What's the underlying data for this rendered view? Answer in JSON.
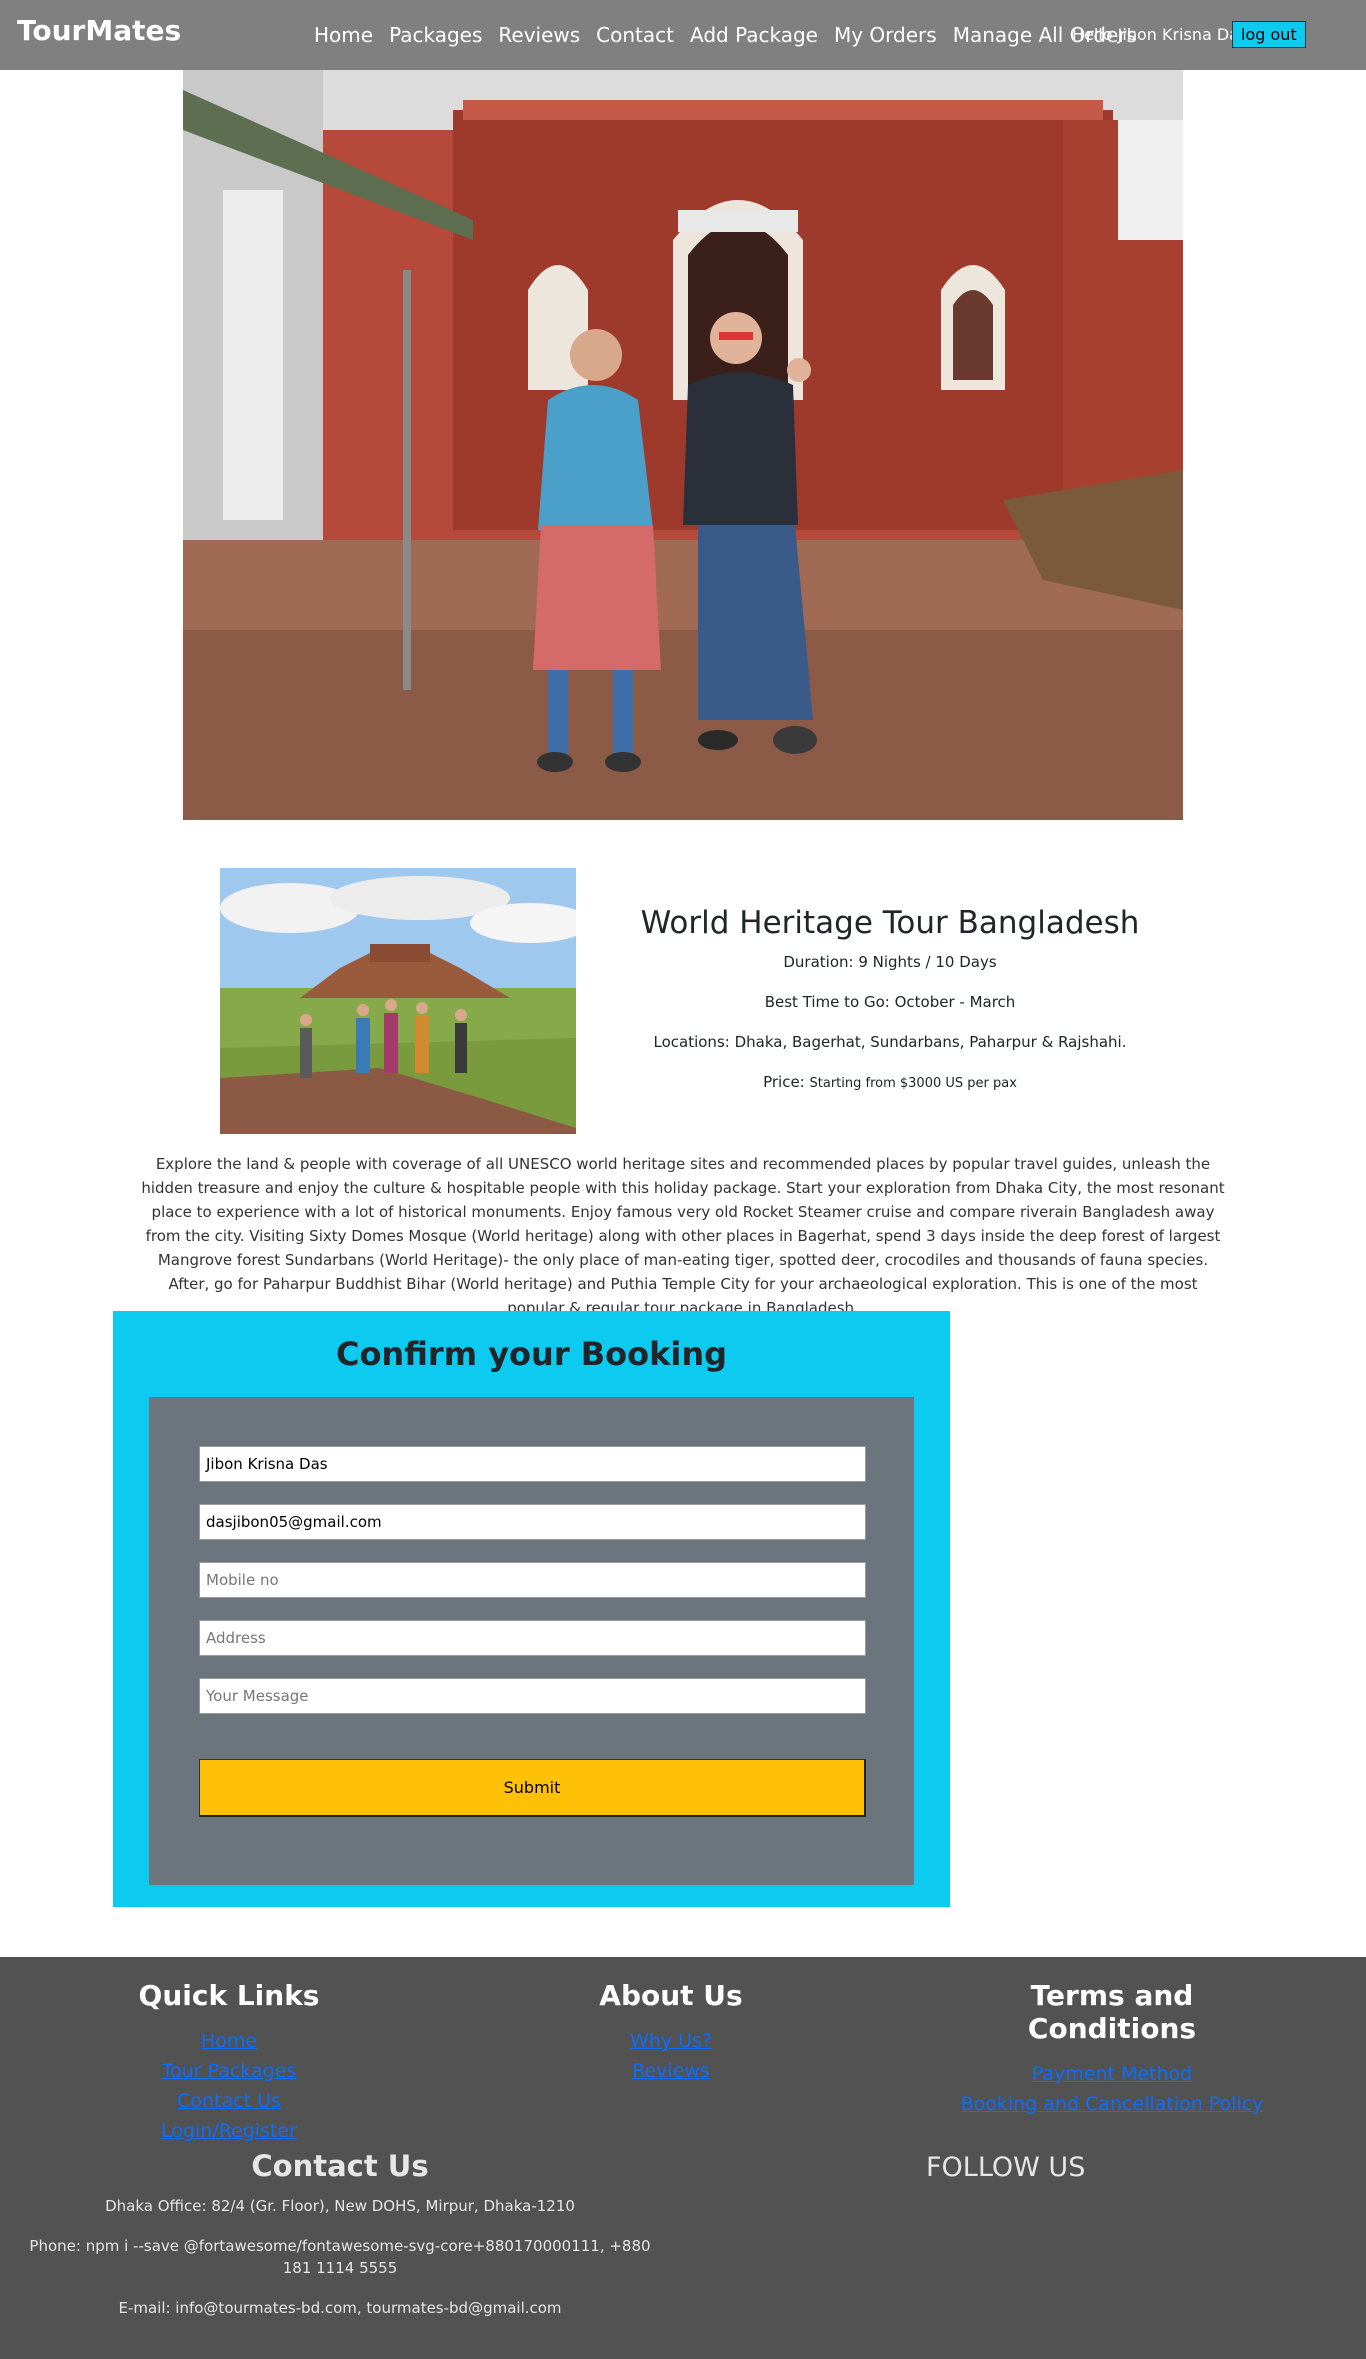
{
  "nav": {
    "brand": "TourMates",
    "links": [
      "Home",
      "Packages",
      "Reviews",
      "Contact",
      "Add Package",
      "My Orders",
      "Manage All Orders"
    ],
    "greeting": "Hello Jibon Krisna Das",
    "logout": "log out"
  },
  "package": {
    "title": "World Heritage Tour Bangladesh",
    "duration": "Duration: 9 Nights / 10 Days",
    "best_time": "Best Time to Go: October - March",
    "locations": "Locations: Dhaka, Bagerhat, Sundarbans, Paharpur & Rajshahi.",
    "price_label": "Price:",
    "price_value": "Starting from $3000 US per pax",
    "description": "Explore the land & people with coverage of all UNESCO world heritage sites and recommended places by popular travel guides, unleash the hidden treasure and enjoy the culture & hospitable people with this holiday package. Start your exploration from Dhaka City, the most resonant place to experience with a lot of historical monuments. Enjoy famous very old Rocket Steamer cruise and compare riverain Bangladesh away from the city. Visiting Sixty Domes Mosque (World heritage) along with other places in Bagerhat, spend 3 days inside the deep forest of largest Mangrove forest Sundarbans (World Heritage)- the only place of man-eating tiger, spotted deer, crocodiles and thousands of fauna species. After, go for Paharpur Buddhist Bihar (World heritage) and Puthia Temple City for your archaeological exploration. This is one of the most popular & regular tour package in Bangladesh."
  },
  "booking": {
    "title": "Confirm your Booking",
    "name_value": "Jibon Krisna Das",
    "email_value": "dasjibon05@gmail.com",
    "mobile_placeholder": "Mobile no",
    "address_placeholder": "Address",
    "message_placeholder": "Your Message",
    "submit": "Submit"
  },
  "footer": {
    "quick_links": {
      "title": "Quick Links",
      "items": [
        "Home",
        "Tour Packages",
        "Contact Us",
        "Login/Register"
      ]
    },
    "about": {
      "title": "About Us",
      "items": [
        "Why Us?",
        "Reviews"
      ]
    },
    "terms": {
      "title": "Terms and Conditions",
      "items": [
        "Payment Method",
        "Booking and Cancellation Policy"
      ]
    },
    "contact": {
      "title": "Contact Us",
      "office": "Dhaka Office: 82/4 (Gr. Floor), New DOHS, Mirpur, Dhaka-1210",
      "phone": "Phone: npm i --save @fortawesome/fontawesome-svg-core+880170000111, +880 181 1114 5555",
      "email": "E-mail: info@tourmates-bd.com, tourmates-bd@gmail.com"
    },
    "follow": "FOLLOW US"
  },
  "colors": {
    "navbar": "#808080",
    "accent_cyan": "#0dcaf0",
    "form_bg": "#6c757d",
    "submit": "#ffc107",
    "footer": "#525252",
    "link": "#0d6efd"
  }
}
